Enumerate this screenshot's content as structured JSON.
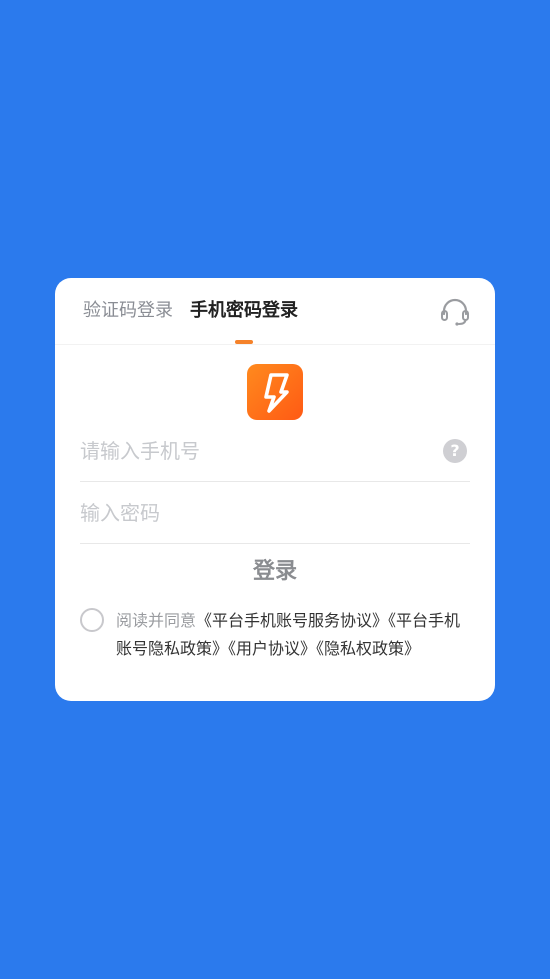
{
  "tabs": {
    "sms_login": "验证码登录",
    "password_login": "手机密码登录",
    "active": "password_login"
  },
  "icons": {
    "support": "headset-icon",
    "logo": "lightning-bolt-logo",
    "help": "question-circle-icon"
  },
  "colors": {
    "background": "#2b7aed",
    "accent": "#f5822a",
    "logo_gradient_start": "#ff8a1e",
    "logo_gradient_end": "#ff5a14"
  },
  "form": {
    "phone_placeholder": "请输入手机号",
    "phone_value": "",
    "password_placeholder": "输入密码",
    "password_value": "",
    "help_symbol": "?",
    "login_label": "登录"
  },
  "agreement": {
    "checked": false,
    "prefix": "阅读并同意",
    "links": [
      "《平台手机账号服务协议》",
      "《平台手机账号隐私政策》",
      "《用户协议》",
      "《隐私权政策》"
    ]
  }
}
